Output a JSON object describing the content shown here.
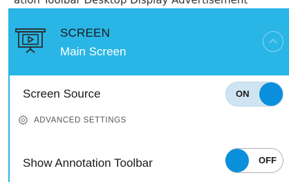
{
  "header": {
    "title": "SCREEN",
    "subtitle": "Main Screen",
    "icon": "presentation-screen-icon",
    "collapse_icon": "chevron-up-icon"
  },
  "top_cut_text": "ation Toolbar Desktop Display Advertisement",
  "rows": {
    "screen_source": {
      "label": "Screen Source",
      "state": "ON"
    },
    "advanced": {
      "label": "ADVANCED SETTINGS",
      "icon": "gear-icon"
    },
    "annotation_toolbar": {
      "label": "Show Annotation Toolbar",
      "state": "OFF"
    }
  },
  "colors": {
    "header_bg": "#29b6e6",
    "toggle_knob": "#0a8fdc",
    "toggle_on_track": "#cfe4f2"
  }
}
